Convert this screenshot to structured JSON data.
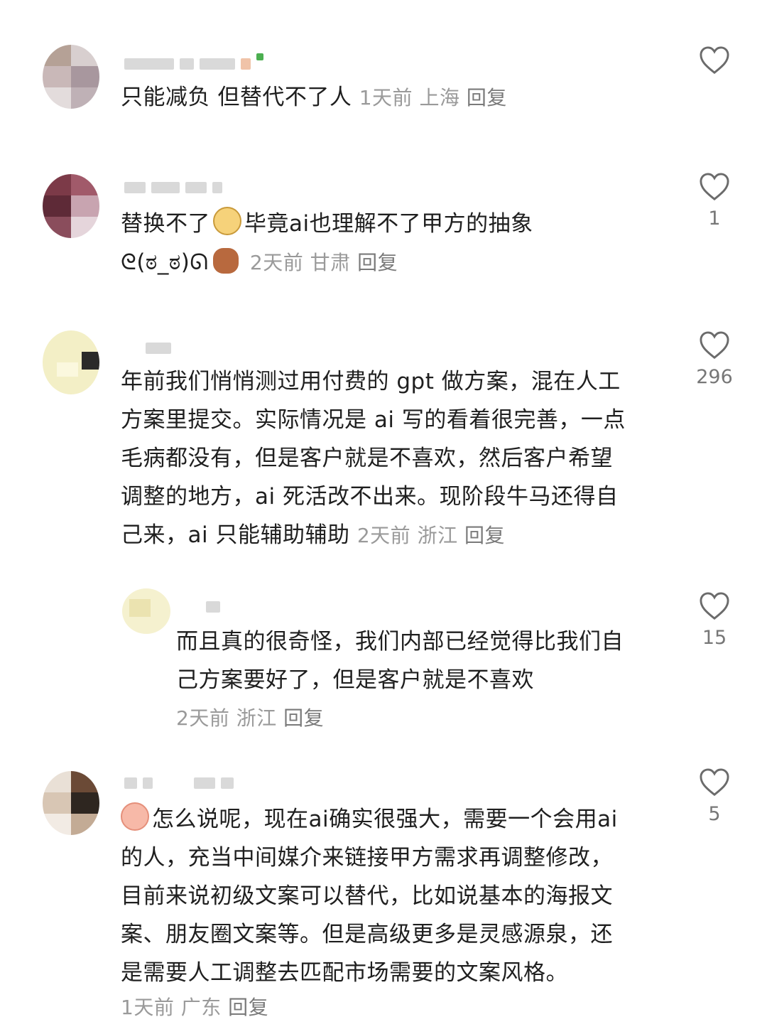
{
  "comments": [
    {
      "text": "只能减负 但替代不了人",
      "time": "1天前",
      "location": "上海",
      "reply_label": "回复",
      "likes": ""
    },
    {
      "text": "替换不了",
      "text2": "毕竟ai也理解不了甲方的抽象",
      "text3": "ᘓ(ಠ_ಠ)ᘏ",
      "time": "2天前",
      "location": "甘肃",
      "reply_label": "回复",
      "likes": "1"
    },
    {
      "lines": [
        "年前我们悄悄测过用付费的 gpt 做方案，混在人工",
        "方案里提交。实际情况是 ai 写的看着很完善，一点",
        "毛病都没有，但是客户就是不喜欢，然后客户希望",
        "调整的地方，ai 死活改不出来。现阶段牛马还得自",
        "己来，ai 只能辅助辅助"
      ],
      "time": "2天前",
      "location": "浙江",
      "reply_label": "回复",
      "likes": "296"
    },
    {
      "lines": [
        "而且真的很奇怪，我们内部已经觉得比我们自",
        "己方案要好了，但是客户就是不喜欢"
      ],
      "time": "2天前",
      "location": "浙江",
      "reply_label": "回复",
      "likes": "15"
    },
    {
      "lines": [
        "怎么说呢，现在ai确实很强大，需要一个会用ai",
        "的人，充当中间媒介来链接甲方需求再调整修改，",
        "目前来说初级文案可以替代，比如说基本的海报文",
        "案、朋友圈文案等。但是高级更多是灵感源泉，还",
        "是需要人工调整去匹配市场需要的文案风格。"
      ],
      "time": "1天前",
      "location": "广东",
      "reply_label": "回复",
      "likes": "5"
    }
  ]
}
